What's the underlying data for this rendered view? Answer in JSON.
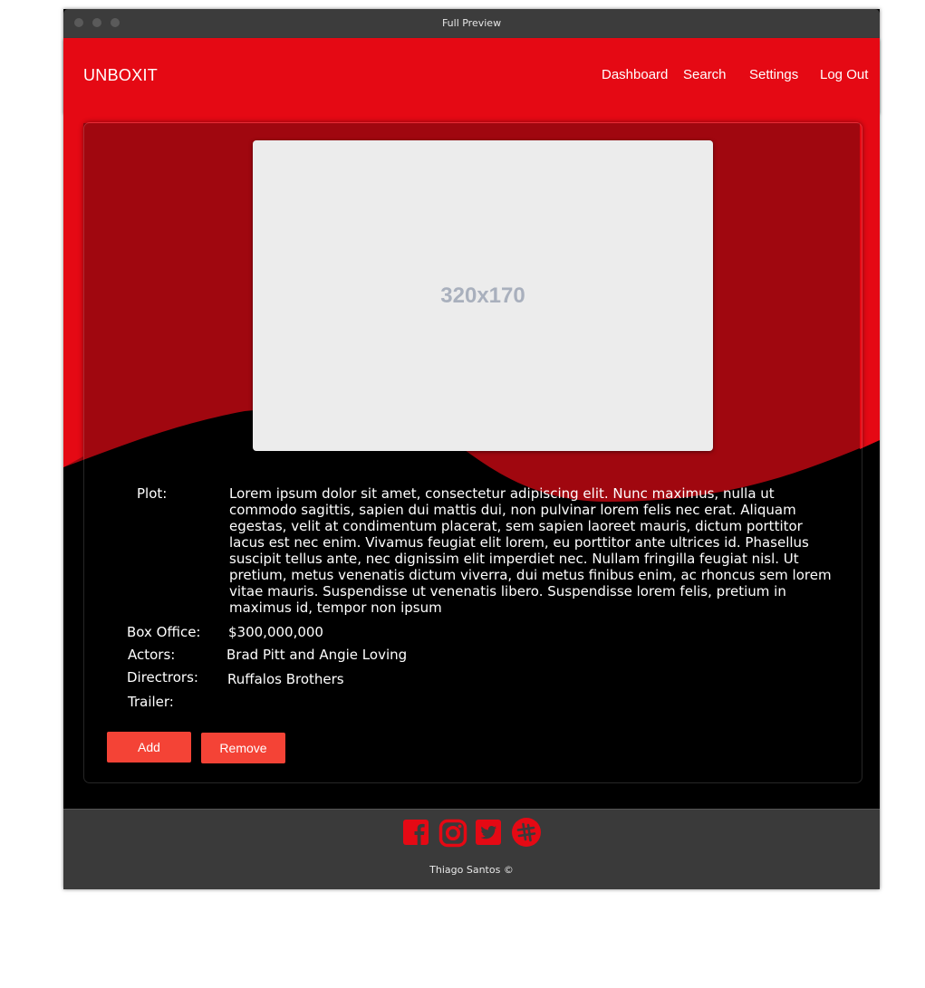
{
  "window": {
    "title": "Full Preview"
  },
  "navbar": {
    "brand": "UNBOXIT",
    "links": [
      "Dashboard",
      "Search",
      "Settings",
      "Log Out"
    ]
  },
  "movie": {
    "poster_placeholder": "320x170",
    "plot_label": "Plot:",
    "plot": "Lorem ipsum dolor sit amet, consectetur adipiscing elit. Nunc maximus, nulla ut commodo sagittis, sapien dui mattis dui, non pulvinar lorem felis nec erat. Aliquam egestas, velit at condimentum placerat, sem sapien laoreet mauris, dictum porttitor lacus est nec enim. Vivamus feugiat elit lorem, eu porttitor ante ultrices id. Phasellus suscipit tellus ante, nec dignissim elit imperdiet nec. Nullam fringilla feugiat nisl. Ut pretium, metus venenatis dictum viverra, dui metus finibus enim, ac rhoncus sem lorem vitae mauris. Suspendisse ut venenatis libero. Suspendisse lorem felis, pretium in maximus id, tempor non ipsum",
    "box_office_label": "Box Office:",
    "box_office": "$300,000,000",
    "actors_label": "Actors:",
    "actors": "Brad Pitt and Angie Loving",
    "directors_label": "Directrors:",
    "directors": "Ruffalos Brothers",
    "trailer_label": "Trailer:"
  },
  "actions": {
    "add_label": "Add",
    "remove_label": "Remove"
  },
  "footer": {
    "icons": [
      "facebook-icon",
      "instagram-icon",
      "twitter-icon",
      "slack-icon"
    ],
    "copyright": "Thiago Santos ©"
  },
  "colors": {
    "brand_red": "#e50914",
    "dark_red": "#a0070f",
    "button_red": "#f44336",
    "background": "#000000",
    "footer": "#3a3a3a"
  }
}
